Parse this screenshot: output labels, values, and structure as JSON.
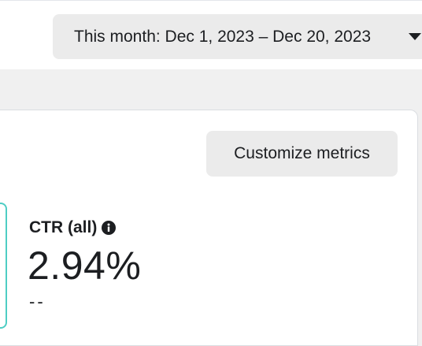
{
  "date_picker": {
    "label": "This month: Dec 1, 2023 – Dec 20, 2023",
    "caret_icon": "caret-down-icon"
  },
  "toolbar": {
    "customize_label": "Customize metrics"
  },
  "metric": {
    "name": "CTR (all)",
    "info_icon": "info-icon",
    "value": "2.94%",
    "comparison": "--"
  },
  "colors": {
    "page_background": "#f0f0f0",
    "button_background": "#ebebeb",
    "selected_tile_border": "#4ecdc4",
    "text": "#1c1e21"
  }
}
